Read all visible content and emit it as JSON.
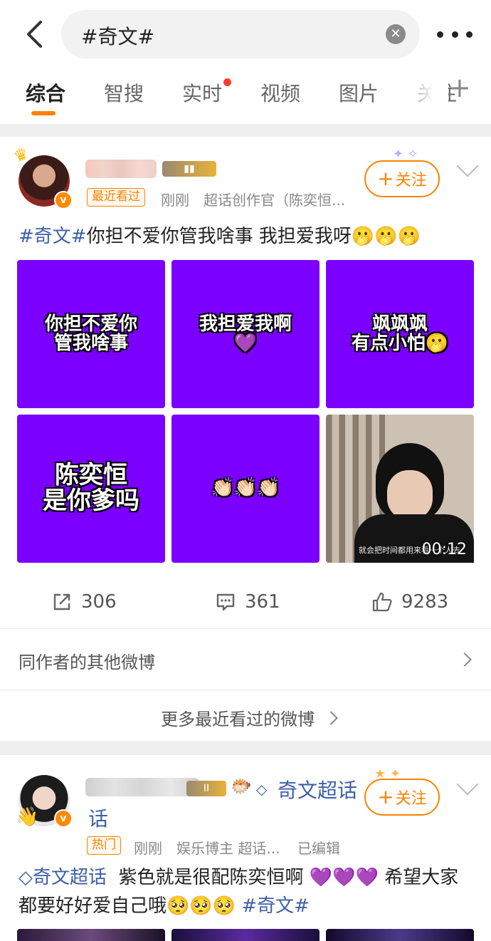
{
  "header": {
    "back_icon": "chevron-left-icon",
    "search_query": "#奇文#",
    "clear_icon": "clear-circle-icon",
    "more_icon": "more-dots-icon"
  },
  "tabs": [
    {
      "label": "综合",
      "active": true
    },
    {
      "label": "智搜"
    },
    {
      "label": "实时",
      "has_dot": true
    },
    {
      "label": "视频"
    },
    {
      "label": "图片"
    },
    {
      "label": "关注"
    }
  ],
  "tabs_add_icon": "plus-icon",
  "accent_color": "#ff8200",
  "post1": {
    "tag": "最近看过",
    "time": "刚刚",
    "source": "超话创作官（陈奕恒...",
    "follow_label": "关注",
    "text_hashtag": "#奇文#",
    "text_body": "你担不爱你管我啥事 我担爱我呀🫢🫢🫢",
    "images": [
      {
        "caption": "你担不爱你\n管我啥事"
      },
      {
        "caption": "我担爱我啊\n💜"
      },
      {
        "caption": "飒飒飒\n有点小怕🫢"
      },
      {
        "caption": "陈奕恒\n是你爹吗"
      },
      {
        "caption": "👏🏻👏🏻👏🏻"
      },
      {
        "caption": "",
        "video_duration": "00:12",
        "video_subtitle": "就会把时间都用来看一个人去"
      }
    ],
    "repost_count": "306",
    "comment_count": "361",
    "like_count": "9283"
  },
  "other_posts_link": "同作者的其他微博",
  "more_recent_link": "更多最近看过的微博",
  "post2": {
    "super_topic": "奇文超话",
    "tag": "热门",
    "time": "刚刚",
    "source": "娱乐博主 超话...",
    "edited": "已编辑",
    "follow_label": "关注",
    "text_topic": "奇文超话",
    "text_body": "紫色就是很配陈奕恒啊 💜💜💜 希望大家都要好好爱自己哦🥺🥺🥺 ",
    "text_hashtag": "#奇文#"
  }
}
